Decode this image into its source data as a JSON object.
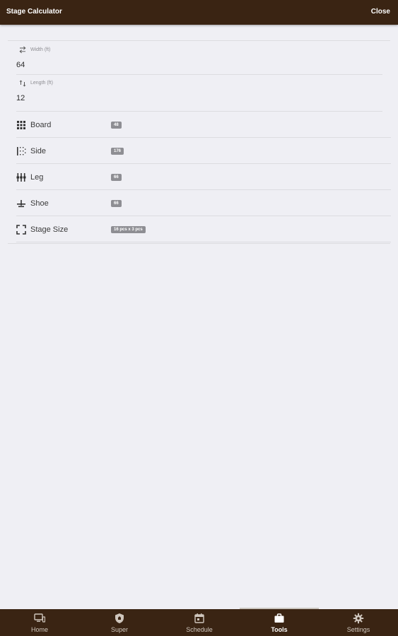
{
  "header": {
    "title": "Stage Calculator",
    "close_label": "Close"
  },
  "form": {
    "width": {
      "label": "Width (ft)",
      "value": "64",
      "icon": "swap-horizontal-icon"
    },
    "length": {
      "label": "Length (ft)",
      "value": "12",
      "icon": "swap-vertical-icon"
    }
  },
  "results": [
    {
      "label": "Board",
      "count": "48",
      "icon": "grid-icon"
    },
    {
      "label": "Side",
      "count": "176",
      "icon": "side-frame-icon"
    },
    {
      "label": "Leg",
      "count": "66",
      "icon": "legs-icon"
    },
    {
      "label": "Shoe",
      "count": "66",
      "icon": "shoe-icon"
    },
    {
      "label": "Stage Size",
      "count": "16 pcs x 3 pcs",
      "icon": "fullscreen-icon"
    }
  ],
  "tabs": [
    {
      "label": "Home",
      "icon": "monitor-icon"
    },
    {
      "label": "Super",
      "icon": "shield-icon"
    },
    {
      "label": "Schedule",
      "icon": "calendar-icon"
    },
    {
      "label": "Tools",
      "icon": "briefcase-icon",
      "active": true
    },
    {
      "label": "Settings",
      "icon": "gear-icon"
    }
  ],
  "colors": {
    "header_bg": "#3a2413",
    "page_bg": "#efeff4",
    "badge_bg": "#8e8e93"
  }
}
